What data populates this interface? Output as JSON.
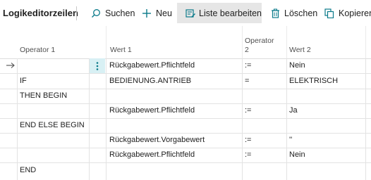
{
  "toolbar": {
    "title": "Logikeditorzeilen",
    "search": "Suchen",
    "new": "Neu",
    "edit_list": "Liste bearbeiten",
    "delete": "Löschen",
    "copy": "Kopieren"
  },
  "columns": {
    "op1": "Operator 1",
    "val1": "Wert 1",
    "op2_line1": "Operator",
    "op2_line2": "2",
    "val2": "Wert 2"
  },
  "rows": [
    {
      "op1": "",
      "val1": "Rückgabewert.Pflichtfeld",
      "op2": ":=",
      "val2": "Nein"
    },
    {
      "op1": "IF",
      "val1": "BEDIENUNG.ANTRIEB",
      "op2": "=",
      "val2": "ELEKTRISCH"
    },
    {
      "op1": "THEN BEGIN",
      "val1": "",
      "op2": "",
      "val2": ""
    },
    {
      "op1": "",
      "val1": "Rückgabewert.Pflichtfeld",
      "op2": ":=",
      "val2": "Ja"
    },
    {
      "op1": "END ELSE BEGIN",
      "val1": "",
      "op2": "",
      "val2": ""
    },
    {
      "op1": "",
      "val1": "Rückgabewert.Vorgabewert",
      "op2": ":=",
      "val2": "''"
    },
    {
      "op1": "",
      "val1": "Rückgabewert.Pflichtfeld",
      "op2": ":=",
      "val2": "Nein"
    },
    {
      "op1": "END",
      "val1": "",
      "op2": "",
      "val2": ""
    }
  ],
  "colors": {
    "accent": "#0a7a8a",
    "active_bg": "#e6e6e6",
    "selected_menu_bg": "#d8f0f4"
  }
}
